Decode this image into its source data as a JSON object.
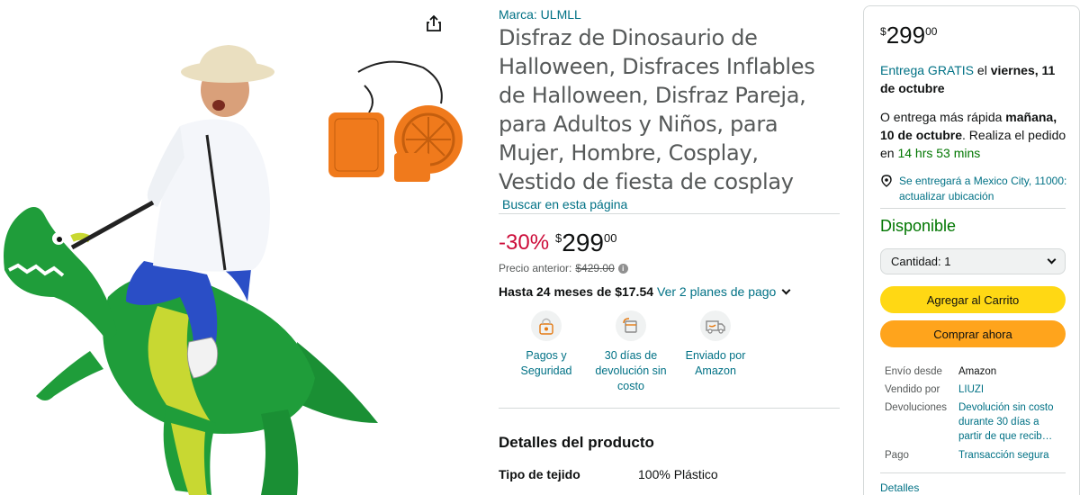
{
  "product": {
    "brand": "Marca: ULMLL",
    "title": "Disfraz de Dinosaurio de Halloween, Disfraces Inflables de Halloween, Disfraz Pareja, para Adultos y Niños, para Mujer, Hombre, Cosplay, Vestido de fiesta de cosplay",
    "search_link": "Buscar en esta página"
  },
  "pricing": {
    "discount": "-30%",
    "currency_symbol": "$",
    "price_whole": "299",
    "price_fraction": "00",
    "previous_label": "Precio anterior:",
    "previous_price": "$429.00",
    "installments_text": "Hasta 24 meses de $17.54",
    "installments_link": "Ver 2 planes de pago"
  },
  "features": [
    {
      "label": "Pagos y Seguridad",
      "icon": "lock-payment-icon"
    },
    {
      "label": "30 días de devolución sin costo",
      "icon": "return-box-icon"
    },
    {
      "label": "Enviado por Amazon",
      "icon": "delivery-truck-icon"
    }
  ],
  "details": {
    "heading": "Detalles del producto",
    "specs": [
      {
        "key": "Tipo de tejido",
        "value": "100% Plástico"
      }
    ]
  },
  "buybox": {
    "currency_symbol": "$",
    "price_whole": "299",
    "price_fraction": "00",
    "delivery_link": "Entrega GRATIS",
    "delivery_mid": " el ",
    "delivery_date": "viernes, 11 de octubre",
    "fast_prefix": "O entrega más rápida ",
    "fast_date": "mañana, 10 de octubre",
    "fast_mid": ". Realiza el pedido en ",
    "fast_countdown": "14 hrs 53 mins",
    "location": "Se entregará a Mexico City, 11000: actualizar ubicación",
    "availability": "Disponible",
    "quantity": "Cantidad: 1",
    "add_to_cart": "Agregar al Carrito",
    "buy_now": "Comprar ahora",
    "meta": [
      {
        "key": "Envío desde",
        "value": "Amazon",
        "link": false
      },
      {
        "key": "Vendido por",
        "value": "LIUZI",
        "link": true
      },
      {
        "key": "Devoluciones",
        "value": "Devolución sin costo durante 30 días a partir de que recib…",
        "link": true
      },
      {
        "key": "Pago",
        "value": "Transacción segura",
        "link": true
      }
    ],
    "details_link": "Detalles"
  },
  "colors": {
    "link": "#007185",
    "discount_red": "#cc0c39",
    "in_stock_green": "#007600",
    "cart_yellow": "#ffd814",
    "buy_orange": "#ffa41c",
    "costume_green": "#1f9d3a"
  }
}
